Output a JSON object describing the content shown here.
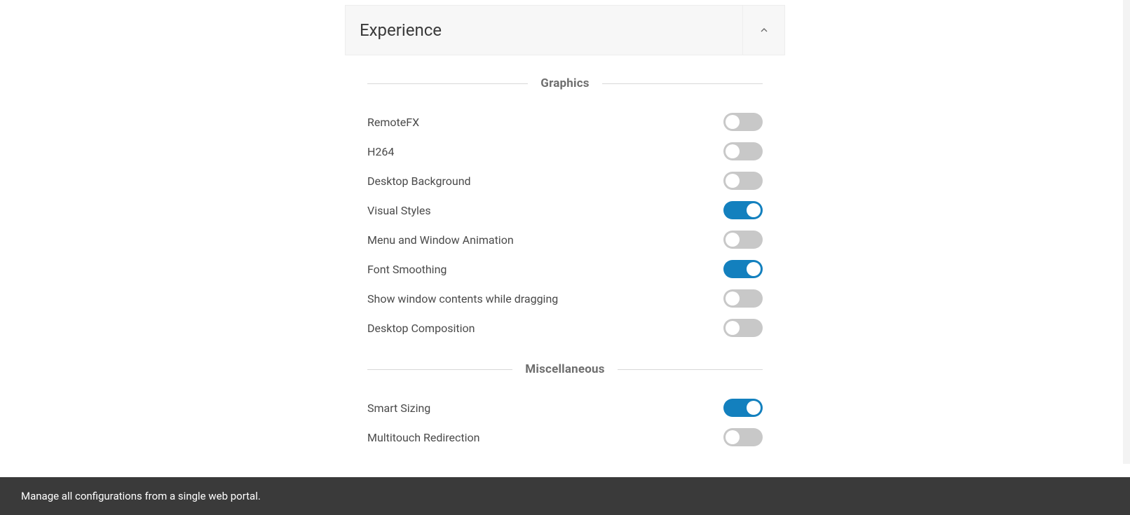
{
  "panel": {
    "title": "Experience"
  },
  "sections": {
    "graphics": {
      "title": "Graphics",
      "items": [
        {
          "label": "RemoteFX",
          "on": false
        },
        {
          "label": "H264",
          "on": false
        },
        {
          "label": "Desktop Background",
          "on": false
        },
        {
          "label": "Visual Styles",
          "on": true
        },
        {
          "label": "Menu and Window Animation",
          "on": false
        },
        {
          "label": "Font Smoothing",
          "on": true
        },
        {
          "label": "Show window contents while dragging",
          "on": false
        },
        {
          "label": "Desktop Composition",
          "on": false
        }
      ]
    },
    "misc": {
      "title": "Miscellaneous",
      "items": [
        {
          "label": "Smart Sizing",
          "on": true
        },
        {
          "label": "Multitouch Redirection",
          "on": false
        }
      ]
    }
  },
  "footer": {
    "text": "Manage all configurations from a single web portal."
  }
}
